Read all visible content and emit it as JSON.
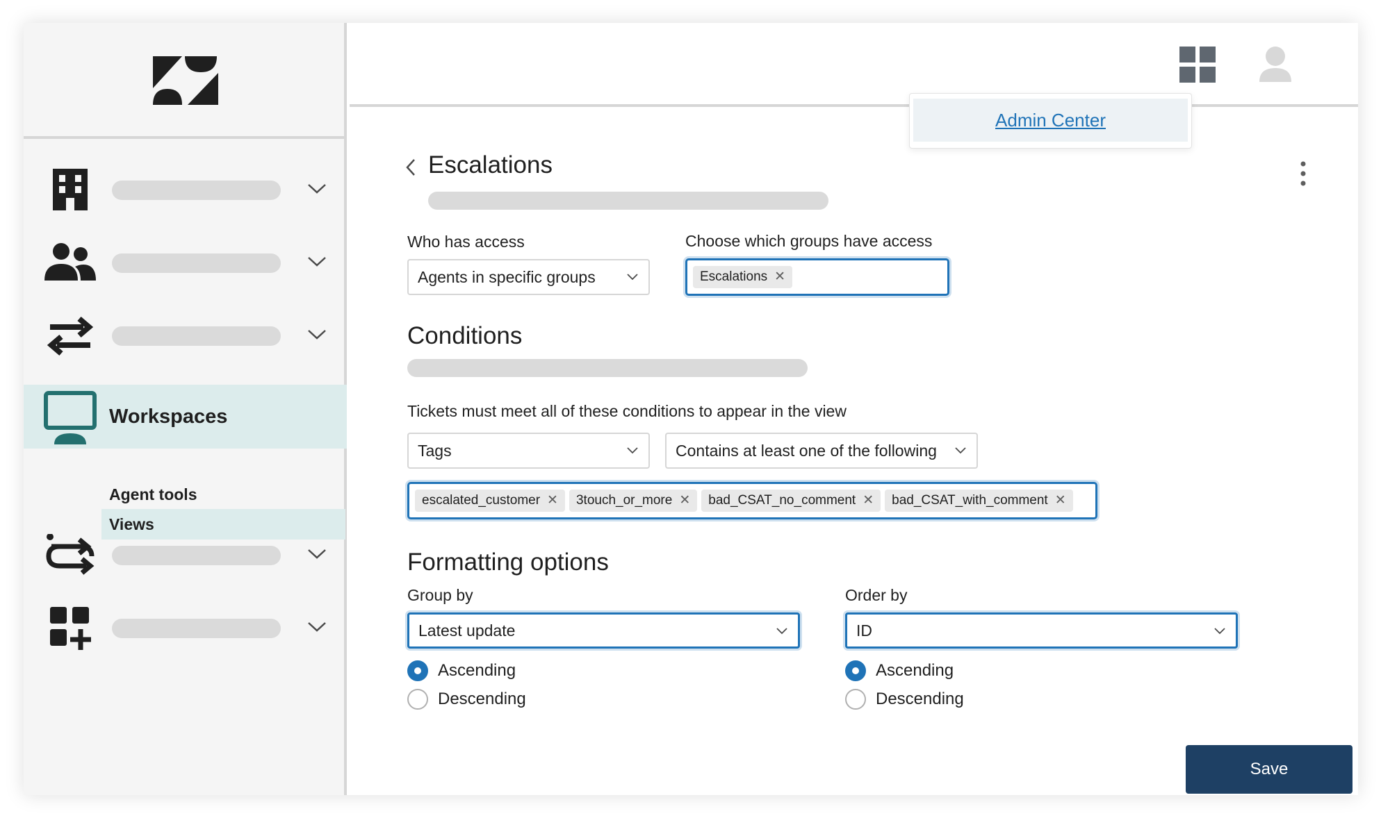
{
  "brand": {
    "logo": "zendesk-logo",
    "accent": "#1f73b7",
    "active_bg": "#dcecec",
    "save_bg": "#1e4064"
  },
  "topbar": {
    "apps_icon": "apps-grid-icon",
    "user_icon": "user-avatar-icon",
    "admin_menu": {
      "item_label": "Admin Center"
    }
  },
  "sidebar": {
    "items": [
      {
        "icon": "building-icon",
        "label": ""
      },
      {
        "icon": "people-icon",
        "label": ""
      },
      {
        "icon": "arrows-swap-icon",
        "label": ""
      },
      {
        "icon": "monitor-icon",
        "label": "Workspaces",
        "active": true,
        "children": [
          {
            "label": "Agent tools"
          },
          {
            "label": "Views",
            "selected": true
          }
        ]
      },
      {
        "icon": "workflow-icon",
        "label": ""
      },
      {
        "icon": "apps-add-icon",
        "label": ""
      }
    ]
  },
  "page": {
    "title": "Escalations",
    "access": {
      "who_label": "Who has access",
      "who_value": "Agents in specific groups",
      "groups_label": "Choose which groups have access",
      "groups": [
        "Escalations"
      ]
    },
    "conditions": {
      "heading": "Conditions",
      "rule_label": "Tickets must meet all of these conditions to appear in the view",
      "field_value": "Tags",
      "operator_value": "Contains at least one of the following",
      "tags": [
        "escalated_customer",
        "3touch_or_more",
        "bad_CSAT_no_comment",
        "bad_CSAT_with_comment"
      ]
    },
    "formatting": {
      "heading": "Formatting options",
      "group_by_label": "Group by",
      "group_by_value": "Latest update",
      "order_by_label": "Order by",
      "order_by_value": "ID",
      "ascending": "Ascending",
      "descending": "Descending",
      "group_direction": "Ascending",
      "order_direction": "Ascending"
    },
    "save_label": "Save"
  }
}
